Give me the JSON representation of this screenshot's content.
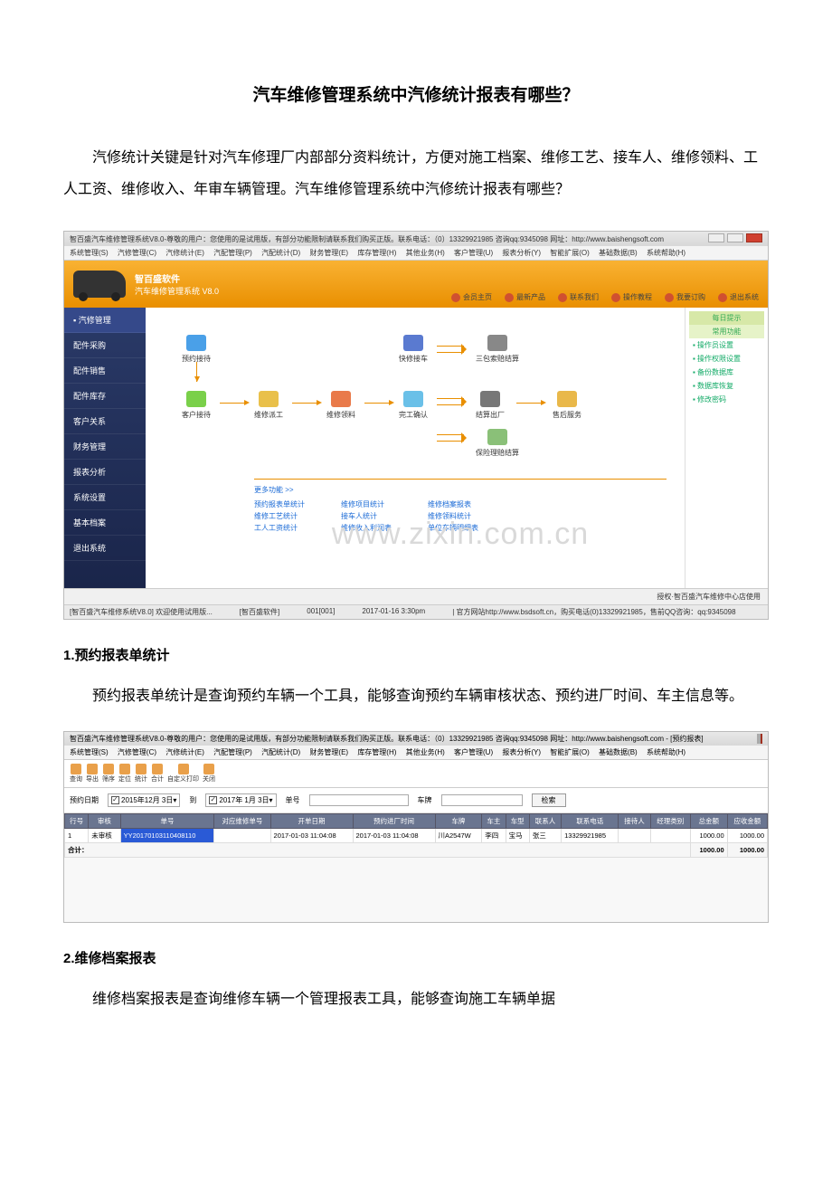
{
  "page": {
    "title": "汽车维修管理系统中汽修统计报表有哪些？",
    "intro": "汽修统计关键是针对汽车修理厂内部部分资料统计，方便对施工档案、维修工艺、接车人、维修领料、工人工资、维修收入、年审车辆管理。汽车维修管理系统中汽修统计报表有哪些？"
  },
  "ss1": {
    "windowTitle": "智百盛汽车维修管理系统V8.0-尊敬的用户：您使用的是试用版，有部分功能限制请联系我们购买正版。联系电话：（0）13329921985 咨询qq:9345098  网址：http://www.baishengsoft.com",
    "menus": [
      "系统管理(S)",
      "汽修管理(C)",
      "汽修统计(E)",
      "汽配管理(P)",
      "汽配统计(D)",
      "财务管理(E)",
      "库存管理(H)",
      "其他业务(H)",
      "客户管理(U)",
      "报表分析(Y)",
      "智能扩展(O)",
      "基础数据(B)",
      "系统帮助(H)"
    ],
    "brand": {
      "name": "智百盛软件",
      "product": "汽车维修管理系统 V8.0"
    },
    "toolbar": [
      "会员主页",
      "最新产品",
      "联系我们",
      "操作教程",
      "我要订购",
      "退出系统"
    ],
    "sidebar": [
      "▪ 汽修管理",
      "配件采购",
      "配件销售",
      "配件库存",
      "客户关系",
      "财务管理",
      "报表分析",
      "系统设置",
      "基本档案",
      "退出系统"
    ],
    "flow": {
      "n1": "预约接待",
      "n2": "客户接待",
      "n3": "维修派工",
      "n4": "维修领料",
      "n5": "快修接车",
      "n6": "完工确认",
      "n7": "三包索赔结算",
      "n8": "结算出厂",
      "n9": "保险理赔结算",
      "n10": "售后服务"
    },
    "more": "更多功能 >>",
    "quicklinks": {
      "col1": [
        "预约报表单统计",
        "维修工艺统计",
        "工人工资统计"
      ],
      "col2": [
        "维修项目统计",
        "接车人统计",
        "维修收入利润表"
      ],
      "col3": [
        "维修档案报表",
        "维修领料统计",
        "单位车辆明细表"
      ]
    },
    "watermark": "www.zixin.com.cn",
    "rightPanel": {
      "hd": "每日提示",
      "hd2": "常用功能",
      "items": [
        "▪ 操作员设置",
        "▪ 操作权限设置",
        "▪ 备份数据库",
        "▪ 数据库恢复",
        "▪ 修改密码"
      ]
    },
    "footer": "授权·智百盛汽车维修中心店使用",
    "status": {
      "s1": "[智百盛汽车维修系统V8.0]  欢迎使用试用版...",
      "s2": "[智百盛软件]",
      "s3": "001[001]",
      "s4": "2017-01-16 3:30pm",
      "s5": "| 官方网站http://www.bsdsoft.cn，购买电话(0)13329921985，售前QQ咨询：qq:9345098"
    }
  },
  "section1": {
    "heading": "1.预约报表单统计",
    "body": "预约报表单统计是查询预约车辆一个工具，能够查询预约车辆审核状态、预约进厂时间、车主信息等。"
  },
  "ss2": {
    "windowTitle": "智百盛汽车维修管理系统V8.0-尊敬的用户：您使用的是试用版，有部分功能限制请联系我们购买正版。联系电话：（0）13329921985 咨询qq:9345098  网址：http://www.baishengsoft.com - [预约报表]",
    "menus": [
      "系统管理(S)",
      "汽修管理(C)",
      "汽修统计(E)",
      "汽配管理(P)",
      "汽配统计(D)",
      "财务管理(E)",
      "库存管理(H)",
      "其他业务(H)",
      "客户管理(U)",
      "报表分析(Y)",
      "智能扩展(O)",
      "基础数据(B)",
      "系统帮助(H)"
    ],
    "toolbar": [
      "查询",
      "导出",
      "筛序",
      "定位",
      "统计",
      "合计",
      "自定义打印",
      "关闭"
    ],
    "filter": {
      "dateLabel": "预约日期",
      "dateFrom": "2015年12月 3日",
      "to": "到",
      "dateTo": "2017年 1月 3日",
      "billLabel": "单号",
      "plateLabel": "车牌",
      "searchBtn": "检索"
    },
    "headers": [
      "行号",
      "审核",
      "单号",
      "对应维修单号",
      "开单日期",
      "预约进厂时间",
      "车牌",
      "车主",
      "车型",
      "联系人",
      "联系电话",
      "接待人",
      "经理类别",
      "总金额",
      "应收金额"
    ],
    "row1": {
      "idx": "1",
      "audit": "未审核",
      "bill": "YY20170103110408110",
      "repair": "",
      "open": "2017-01-03 11:04:08",
      "arrive": "2017-01-03 11:04:08",
      "plate": "川A2547W",
      "owner": "李四",
      "model": "宝马",
      "contact": "张三",
      "phone": "13329921985",
      "recv": "",
      "mgr": "",
      "total": "1000.00",
      "due": "1000.00"
    },
    "sum": {
      "label": "合计：",
      "total": "1000.00",
      "due": "1000.00"
    }
  },
  "section2": {
    "heading": "2.维修档案报表",
    "body": "维修档案报表是查询维修车辆一个管理报表工具，能够查询施工车辆单据"
  }
}
